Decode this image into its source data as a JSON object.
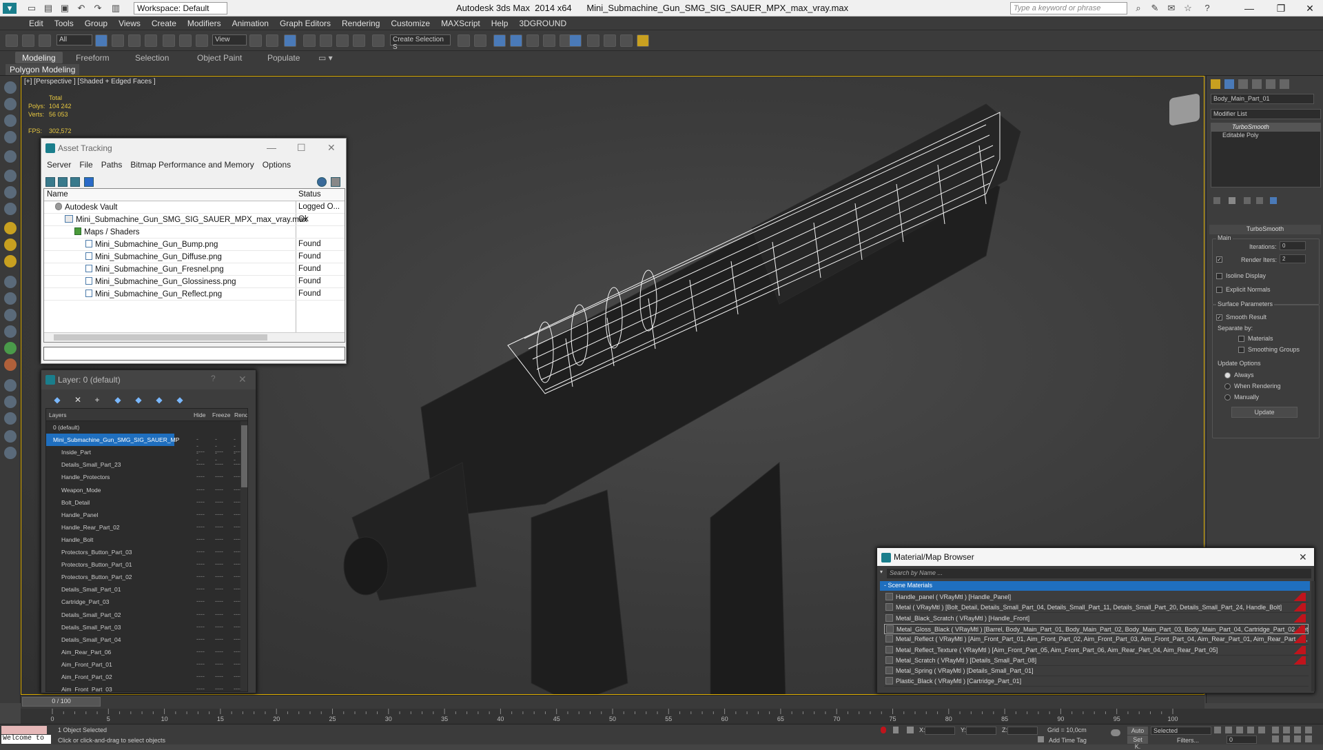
{
  "app": {
    "title": "Autodesk 3ds Max  2014 x64      Mini_Submachine_Gun_SMG_SIG_SAUER_MPX_max_vray.max",
    "workspace": "Workspace: Default",
    "search_placeholder": "Type a keyword or phrase"
  },
  "menu": [
    "Edit",
    "Tools",
    "Group",
    "Views",
    "Create",
    "Modifiers",
    "Animation",
    "Graph Editors",
    "Rendering",
    "Customize",
    "MAXScript",
    "Help",
    "3DGROUND"
  ],
  "toolbar": {
    "filter": "All",
    "view": "View",
    "selection_set": "Create Selection S"
  },
  "ribbon": {
    "tabs": [
      "Modeling",
      "Freeform",
      "Selection",
      "Object Paint",
      "Populate"
    ],
    "sub": "Polygon Modeling"
  },
  "viewport": {
    "label": "[+] [Perspective ] [Shaded + Edged Faces ]",
    "stats": {
      "total_label": "Total",
      "polys_label": "Polys:",
      "polys": "104 242",
      "verts_label": "Verts:",
      "verts": "56 053",
      "fps_label": "FPS:",
      "fps": "302,572"
    }
  },
  "asset_tracking": {
    "title": "Asset Tracking",
    "menu": [
      "Server",
      "File",
      "Paths",
      "Bitmap Performance and Memory",
      "Options"
    ],
    "columns": {
      "name": "Name",
      "status": "Status"
    },
    "rows": [
      {
        "name": "Autodesk Vault",
        "status": "Logged O..."
      },
      {
        "name": "Mini_Submachine_Gun_SMG_SIG_SAUER_MPX_max_vray.max",
        "status": "Ok"
      },
      {
        "name": "Maps / Shaders",
        "status": ""
      },
      {
        "name": "Mini_Submachine_Gun_Bump.png",
        "status": "Found"
      },
      {
        "name": "Mini_Submachine_Gun_Diffuse.png",
        "status": "Found"
      },
      {
        "name": "Mini_Submachine_Gun_Fresnel.png",
        "status": "Found"
      },
      {
        "name": "Mini_Submachine_Gun_Glossiness.png",
        "status": "Found"
      },
      {
        "name": "Mini_Submachine_Gun_Reflect.png",
        "status": "Found"
      }
    ]
  },
  "layer": {
    "title": "Layer: 0 (default)",
    "help": "?",
    "columns": {
      "layers": "Layers",
      "hide": "Hide",
      "freeze": "Freeze",
      "render": "Rend"
    },
    "rows": [
      "0 (default)",
      "Mini_Submachine_Gun_SMG_SIG_SAUER_MP",
      "Inside_Part",
      "Details_Small_Part_23",
      "Handle_Protectors",
      "Weapon_Mode",
      "Bolt_Detail",
      "Handle_Panel",
      "Handle_Rear_Part_02",
      "Handle_Bolt",
      "Protectors_Button_Part_03",
      "Protectors_Button_Part_01",
      "Protectors_Button_Part_02",
      "Details_Small_Part_01",
      "Cartridge_Part_03",
      "Details_Small_Part_02",
      "Details_Small_Part_03",
      "Details_Small_Part_04",
      "Aim_Rear_Part_06",
      "Aim_Front_Part_01",
      "Aim_Front_Part_02",
      "Aim_Front_Part_03"
    ],
    "dots": "----"
  },
  "material_browser": {
    "title": "Material/Map Browser",
    "search": "Search by Name ...",
    "group": "- Scene Materials",
    "rows": [
      "Handle_panel  ( VRayMtl ) [Handle_Panel]",
      "Metal  ( VRayMtl ) [Bolt_Detail, Details_Small_Part_04, Details_Small_Part_11, Details_Small_Part_20, Details_Small_Part_24, Handle_Bolt]",
      "Metal_Black_Scratch  ( VRayMtl ) [Handle_Front]",
      "Metal_Gloss_Black  ( VRayMtl ) [Barrel, Body_Main_Part_01, Body_Main_Part_02, Body_Main_Part_03, Body_Main_Part_04, Cartridge_Part_02, Details_S...",
      "Metal_Reflect  ( VRayMtl ) [Aim_Front_Part_01, Aim_Front_Part_02, Aim_Front_Part_03, Aim_Front_Part_04, Aim_Rear_Part_01, Aim_Rear_Part_02, Aim...",
      "Metal_Reflect_Texture  ( VRayMtl ) [Aim_Front_Part_05, Aim_Front_Part_06, Aim_Rear_Part_04, Aim_Rear_Part_05]",
      "Metal_Scratch  ( VRayMtl ) [Details_Small_Part_08]",
      "Metal_Spring  ( VRayMtl ) [Details_Small_Part_01]",
      "Plastic_Black  ( VRayMtl ) [Cartridge_Part_01]"
    ]
  },
  "command_panel": {
    "object_name": "Body_Main_Part_01",
    "modifier_list": "Modifier List",
    "stack": [
      "TurboSmooth",
      "Editable Poly"
    ],
    "rollout": "TurboSmooth",
    "main": "Main",
    "iterations_label": "Iterations:",
    "iterations": "0",
    "render_iters_label": "Render Iters:",
    "render_iters": "2",
    "isoline": "Isoline Display",
    "explicit": "Explicit Normals",
    "surface": "Surface Parameters",
    "smooth_result": "Smooth Result",
    "separate_by": "Separate by:",
    "materials": "Materials",
    "smoothing_groups": "Smoothing Groups",
    "update_options": "Update Options",
    "always": "Always",
    "when_rendering": "When Rendering",
    "manually": "Manually",
    "update": "Update"
  },
  "timeline": {
    "frame": "0 / 100",
    "ticks": [
      "0",
      "5",
      "10",
      "15",
      "20",
      "25",
      "30",
      "35",
      "40",
      "45",
      "50",
      "55",
      "60",
      "65",
      "70",
      "75",
      "80",
      "85",
      "90",
      "95",
      "100"
    ]
  },
  "status": {
    "welcome": "Welcome to",
    "selected": "1 Object Selected",
    "hint": "Click or click-and-drag to select objects",
    "x_label": "X:",
    "y_label": "Y:",
    "z_label": "Z:",
    "grid": "Grid = 10,0cm",
    "add_time_tag": "Add Time Tag",
    "auto": "Auto",
    "selected_mode": "Selected",
    "setk": "Set K.",
    "filters": "Filters...",
    "frame_value": "0"
  }
}
